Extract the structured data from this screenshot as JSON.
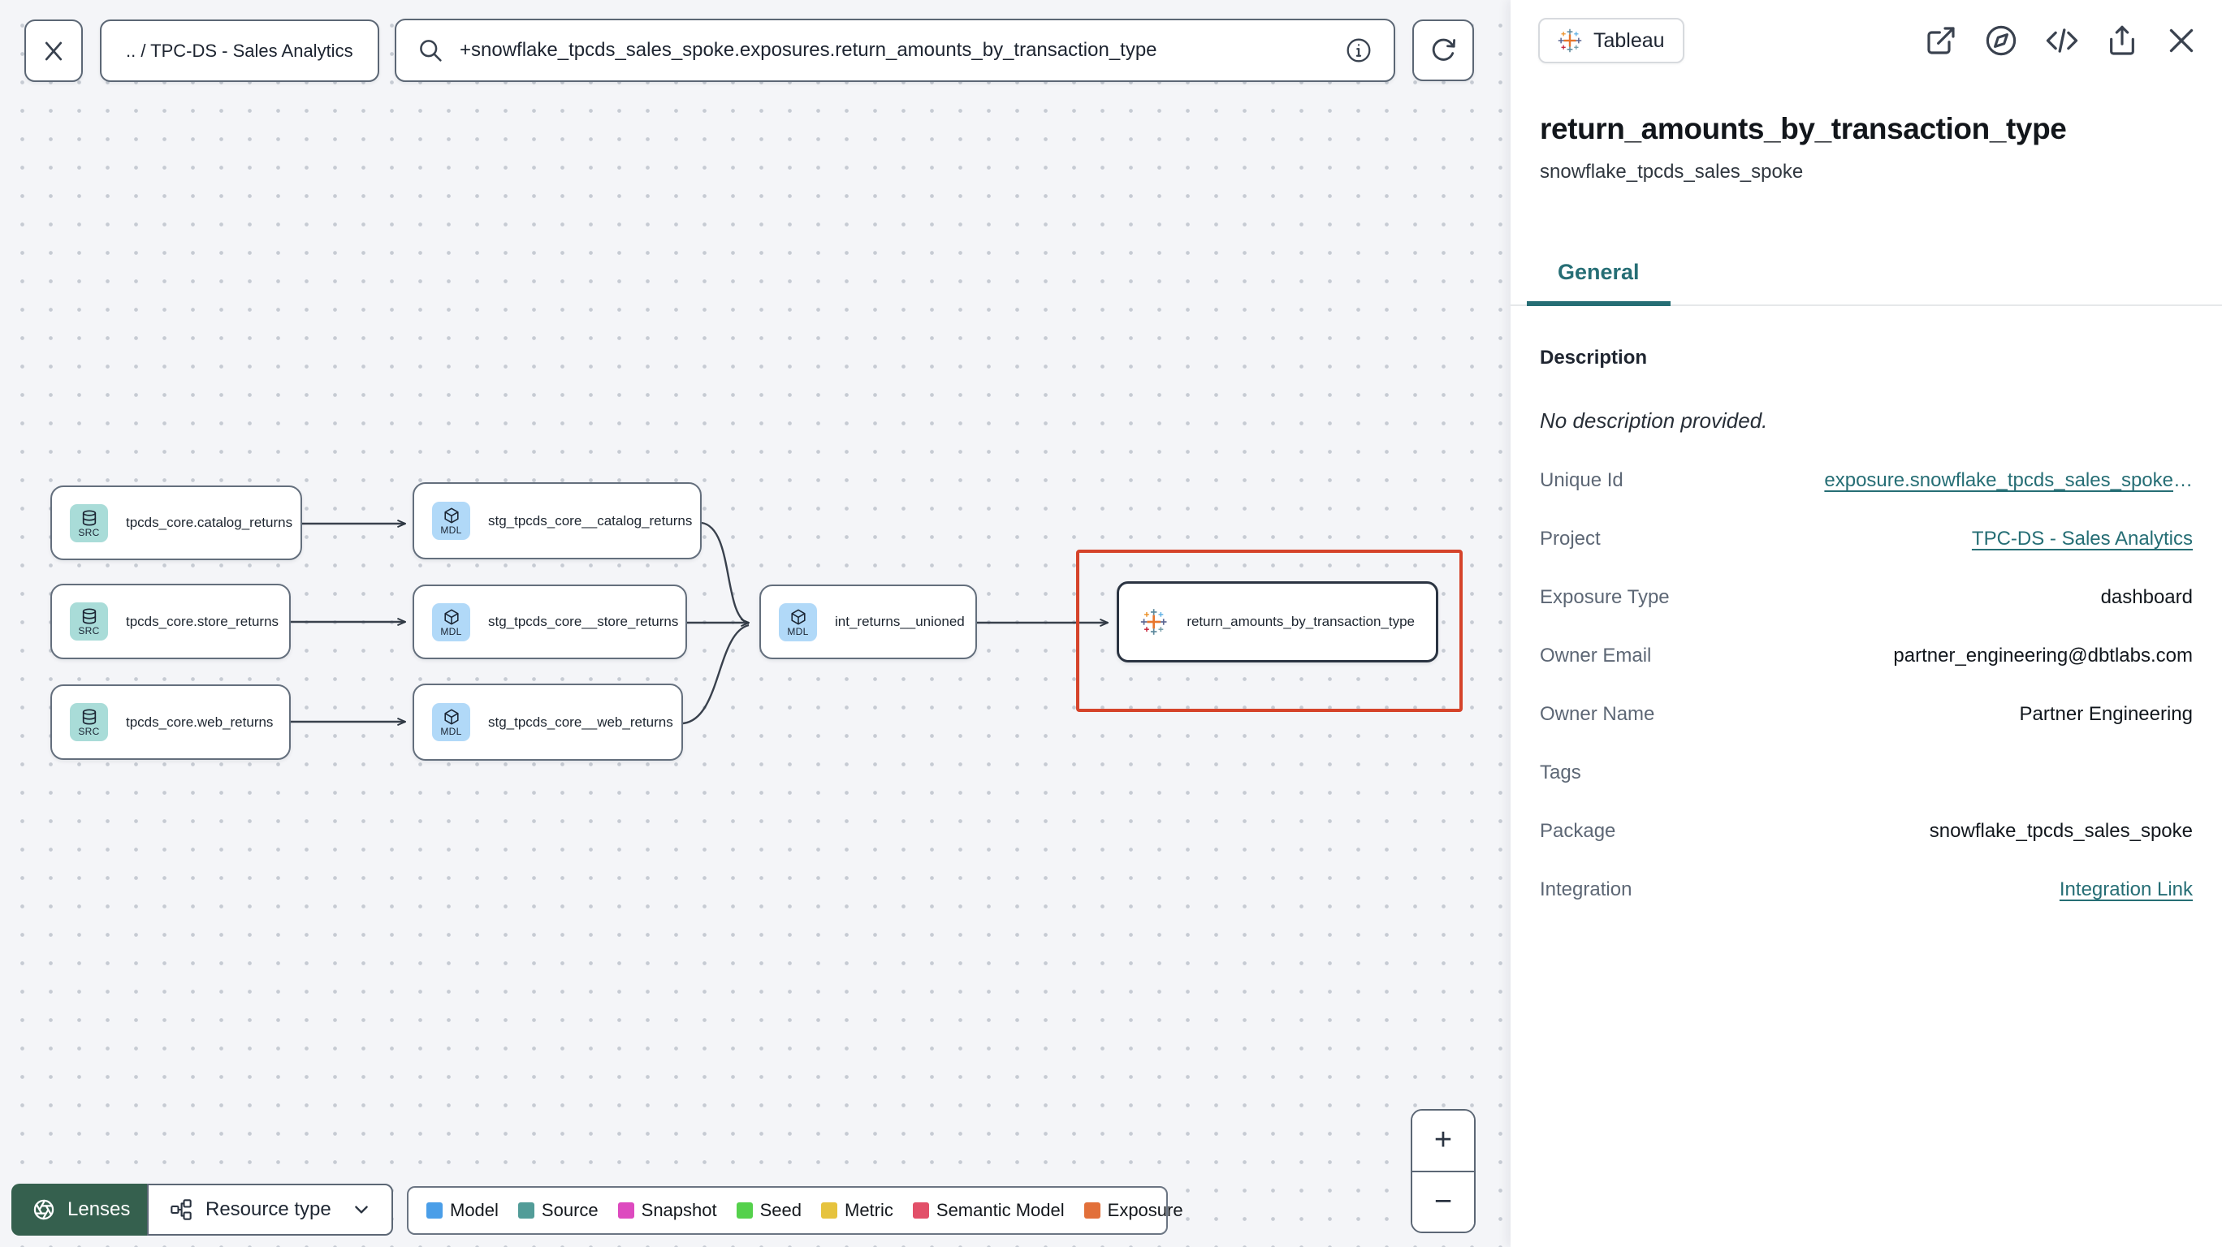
{
  "topbar": {
    "breadcrumb": ".. / TPC-DS - Sales Analytics",
    "search_value": "+snowflake_tpcds_sales_spoke.exposures.return_amounts_by_transaction_type"
  },
  "graph": {
    "nodes": [
      {
        "type": "source",
        "badge": "SRC",
        "label": "tpcds_core.catalog_returns"
      },
      {
        "type": "source",
        "badge": "SRC",
        "label": "tpcds_core.store_returns"
      },
      {
        "type": "source",
        "badge": "SRC",
        "label": "tpcds_core.web_returns"
      },
      {
        "type": "model",
        "badge": "MDL",
        "label": "stg_tpcds_core__catalog_returns"
      },
      {
        "type": "model",
        "badge": "MDL",
        "label": "stg_tpcds_core__store_returns"
      },
      {
        "type": "model",
        "badge": "MDL",
        "label": "stg_tpcds_core__web_returns"
      },
      {
        "type": "model",
        "badge": "MDL",
        "label": "int_returns__unioned"
      },
      {
        "type": "exposure",
        "badge": "",
        "label": "return_amounts_by_transaction_type"
      }
    ]
  },
  "toolbar": {
    "lenses_label": "Lenses",
    "resource_type_label": "Resource type"
  },
  "legend": {
    "items": [
      {
        "label": "Model",
        "color": "#4a9ee8"
      },
      {
        "label": "Source",
        "color": "#529c98"
      },
      {
        "label": "Snapshot",
        "color": "#dd4abf"
      },
      {
        "label": "Seed",
        "color": "#55d14c"
      },
      {
        "label": "Metric",
        "color": "#e6c33e"
      },
      {
        "label": "Semantic Model",
        "color": "#e25069"
      },
      {
        "label": "Exposure",
        "color": "#e2703a"
      }
    ]
  },
  "zoom_controls": {
    "zoom_in": "+",
    "zoom_out": "−"
  },
  "panel": {
    "integration_badge": "Tableau",
    "title": "return_amounts_by_transaction_type",
    "subtitle": "snowflake_tpcds_sales_spoke",
    "tabs": [
      {
        "label": "General",
        "active": true
      }
    ],
    "description_label": "Description",
    "description_empty": "No description provided.",
    "fields": [
      {
        "label": "Unique Id",
        "value": "exposure.snowflake_tpcds_sales_spoke",
        "suffix": "…",
        "link": true
      },
      {
        "label": "Project",
        "value": "TPC-DS - Sales Analytics",
        "link": true
      },
      {
        "label": "Exposure Type",
        "value": "dashboard",
        "link": false
      },
      {
        "label": "Owner Email",
        "value": "partner_engineering@dbtlabs.com",
        "link": false
      },
      {
        "label": "Owner Name",
        "value": "Partner Engineering",
        "link": false
      },
      {
        "label": "Tags",
        "value": "",
        "link": false
      },
      {
        "label": "Package",
        "value": "snowflake_tpcds_sales_spoke",
        "link": false
      },
      {
        "label": "Integration",
        "value": "Integration Link",
        "link": true
      }
    ]
  },
  "icons": {
    "close": "x-mark",
    "search": "magnifier",
    "info": "circled-i",
    "refresh": "rotate-clockwise",
    "lenses": "aperture",
    "resource_type": "sitemap",
    "chevron_down": "chevron-down",
    "external_link": "arrow-out-of-box",
    "explore": "compass",
    "code": "angle-brackets",
    "share": "box-arrow-up",
    "tableau": "tableau-logo",
    "source_node": "database-cylinder",
    "model_node": "cube",
    "zoom_in": "+",
    "zoom_out": "−"
  },
  "colors": {
    "accent_teal": "#266e75",
    "selection_highlight": "#d5432a",
    "lenses_button": "#35604e",
    "source_tile": "#a9dcd8",
    "model_tile": "#b1d9f8",
    "node_border": "#646f7d",
    "canvas_bg": "#f4f5f8"
  }
}
